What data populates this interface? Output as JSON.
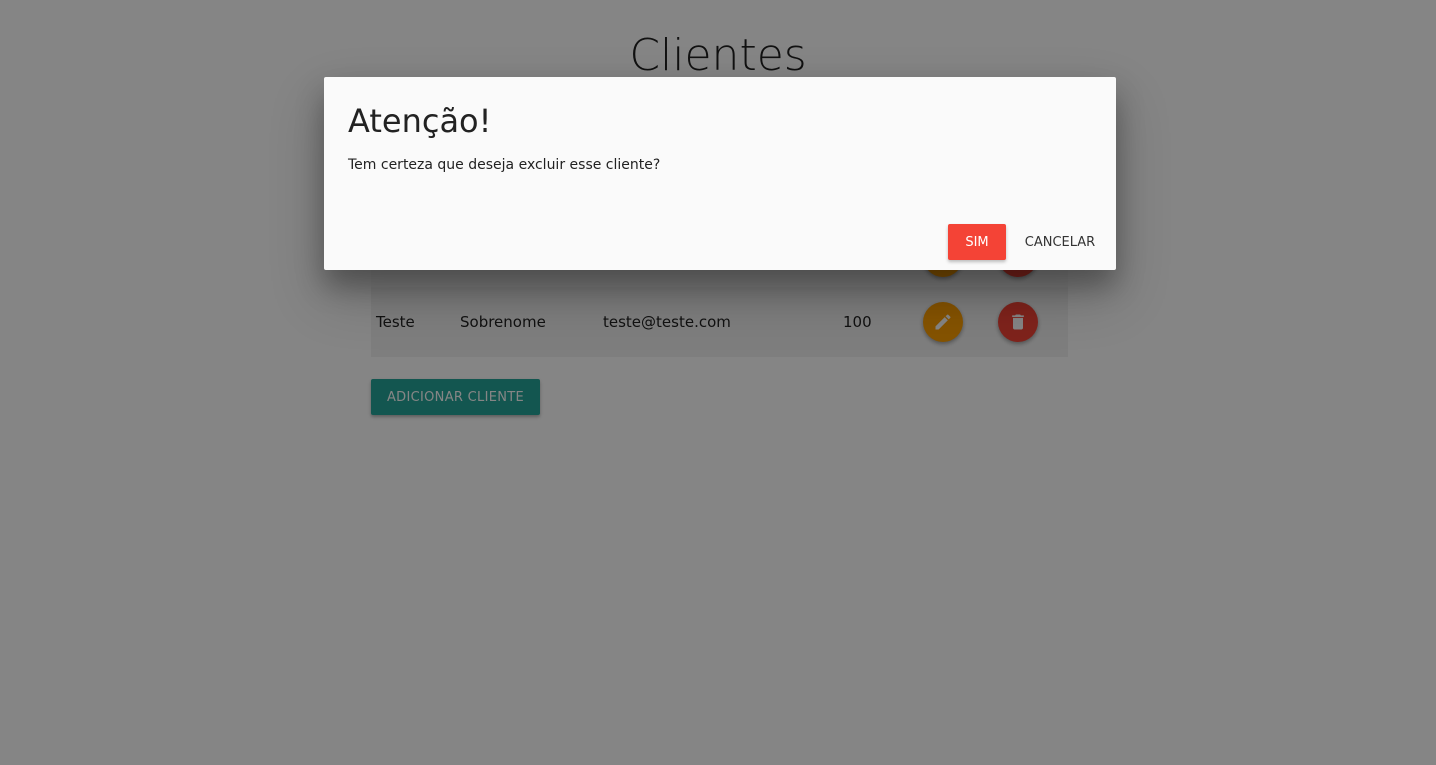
{
  "page": {
    "title": "Clientes"
  },
  "table": {
    "rows": [
      {
        "first_name": "",
        "last_name": "",
        "email": "",
        "value": ""
      },
      {
        "first_name": "Teste",
        "last_name": "Sobrenome",
        "email": "teste@teste.com",
        "value": "100"
      }
    ],
    "edit_icon": "pencil-icon",
    "delete_icon": "trash-icon"
  },
  "actions": {
    "add_client_label": "ADICIONAR CLIENTE"
  },
  "dialog": {
    "title": "Atenção!",
    "message": "Tem certeza que deseja excluir esse cliente?",
    "confirm_label": "SIM",
    "cancel_label": "CANCELAR"
  },
  "colors": {
    "edit": "#ffa000",
    "delete": "#f44336",
    "primary": "#26a69a",
    "overlay": "rgba(0,0,0,0.48)"
  }
}
